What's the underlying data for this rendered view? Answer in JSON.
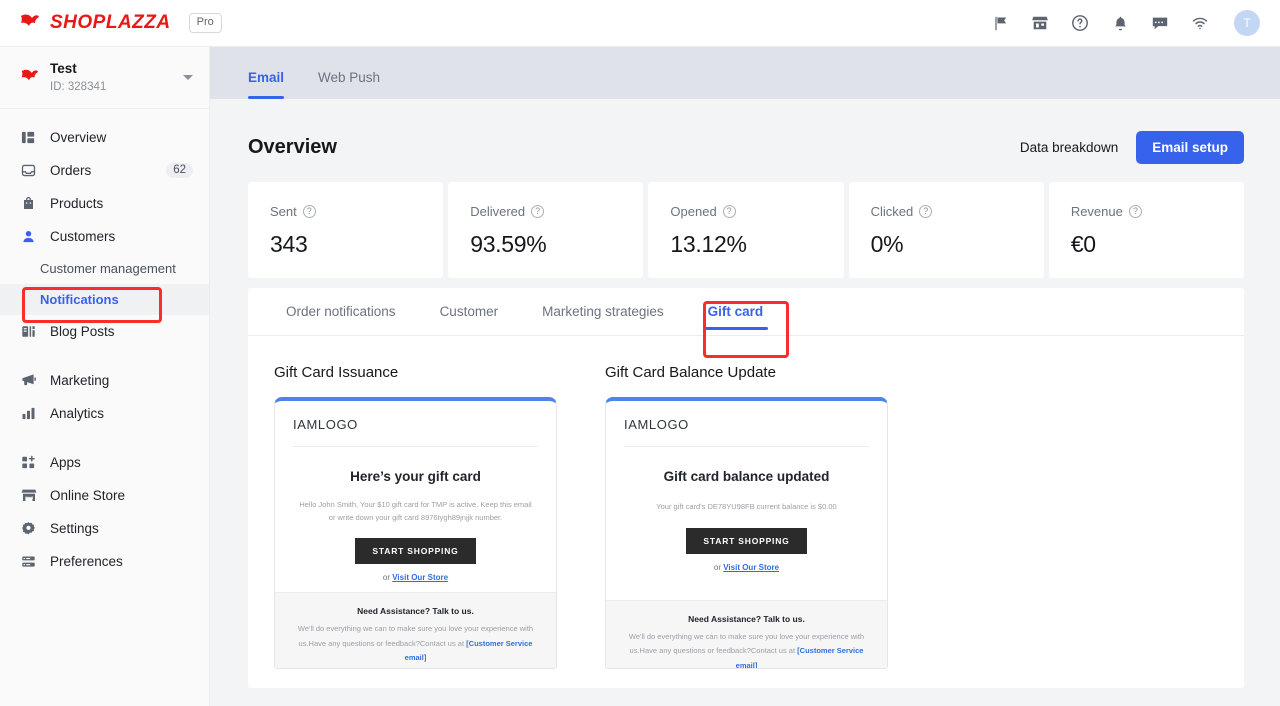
{
  "topbar": {
    "brand": "SHOPLAZZA",
    "plan_badge": "Pro",
    "icons": [
      "flag-icon",
      "store-icon",
      "help-icon",
      "bell-icon",
      "chat-icon",
      "wifi-icon"
    ],
    "avatar_initial": "T"
  },
  "sidebar": {
    "store": {
      "name": "Test",
      "id": "ID: 328341"
    },
    "items": [
      {
        "label": "Overview",
        "icon": "dashboard-icon",
        "badge": ""
      },
      {
        "label": "Orders",
        "icon": "inbox-icon",
        "badge": "62"
      },
      {
        "label": "Products",
        "icon": "bag-icon",
        "badge": ""
      },
      {
        "label": "Customers",
        "icon": "person-icon",
        "badge": ""
      }
    ],
    "sub_items": [
      {
        "label": "Customer management",
        "active": false
      },
      {
        "label": "Notifications",
        "active": true
      }
    ],
    "items_after": [
      {
        "label": "Blog Posts",
        "icon": "article-icon"
      }
    ],
    "group2": [
      {
        "label": "Marketing",
        "icon": "megaphone-icon"
      },
      {
        "label": "Analytics",
        "icon": "bars-icon"
      }
    ],
    "group3": [
      {
        "label": "Apps",
        "icon": "apps-icon"
      },
      {
        "label": "Online Store",
        "icon": "storefront-icon"
      },
      {
        "label": "Settings",
        "icon": "gear-icon"
      },
      {
        "label": "Preferences",
        "icon": "sliders-icon"
      }
    ]
  },
  "tabs": [
    {
      "label": "Email",
      "active": true
    },
    {
      "label": "Web Push",
      "active": false
    }
  ],
  "page": {
    "title": "Overview",
    "data_breakdown_label": "Data breakdown",
    "email_setup_label": "Email setup",
    "accent_color": "#3762ec"
  },
  "stats": [
    {
      "label": "Sent",
      "value": "343"
    },
    {
      "label": "Delivered",
      "value": "93.59%"
    },
    {
      "label": "Opened",
      "value": "13.12%"
    },
    {
      "label": "Clicked",
      "value": "0%"
    },
    {
      "label": "Revenue",
      "value": "€0"
    }
  ],
  "subtabs": [
    {
      "label": "Order notifications",
      "active": false
    },
    {
      "label": "Customer",
      "active": false
    },
    {
      "label": "Marketing strategies",
      "active": false
    },
    {
      "label": "Gift card",
      "active": true
    }
  ],
  "previews": [
    {
      "title": "Gift Card Issuance",
      "logo": "IAMLOGO",
      "heading": "Here’s your gift card",
      "body": "Hello John Smith, Your $10 gift card for TMP is active. Keep this email or write down your gift card 8976tygh89jnjjk number.",
      "button": "START SHOPPING",
      "or_prefix": "or ",
      "or_link": "Visit Our Store",
      "footer_title": "Need Assistance? Talk to us.",
      "footer_text": "We'll do everything we can to make sure you love your experience with us.Have any questions or feedback?Contact us at ",
      "footer_link": "[Customer Service email]"
    },
    {
      "title": "Gift Card Balance Update",
      "logo": "IAMLOGO",
      "heading": "Gift card balance updated",
      "body": "Your gift card's DE78YU98FB current balance is $0.00",
      "button": "START SHOPPING",
      "or_prefix": "or ",
      "or_link": "Visit Our Store",
      "footer_title": "Need Assistance? Talk to us.",
      "footer_text": "We'll do everything we can to make sure you love your experience with us.Have any questions or feedback?Contact us at ",
      "footer_link": "[Customer Service email]"
    }
  ],
  "annotations": {
    "color": "#fb2c2c",
    "boxes": [
      "notifications-sidebar-item",
      "gift-card-subtab"
    ]
  }
}
